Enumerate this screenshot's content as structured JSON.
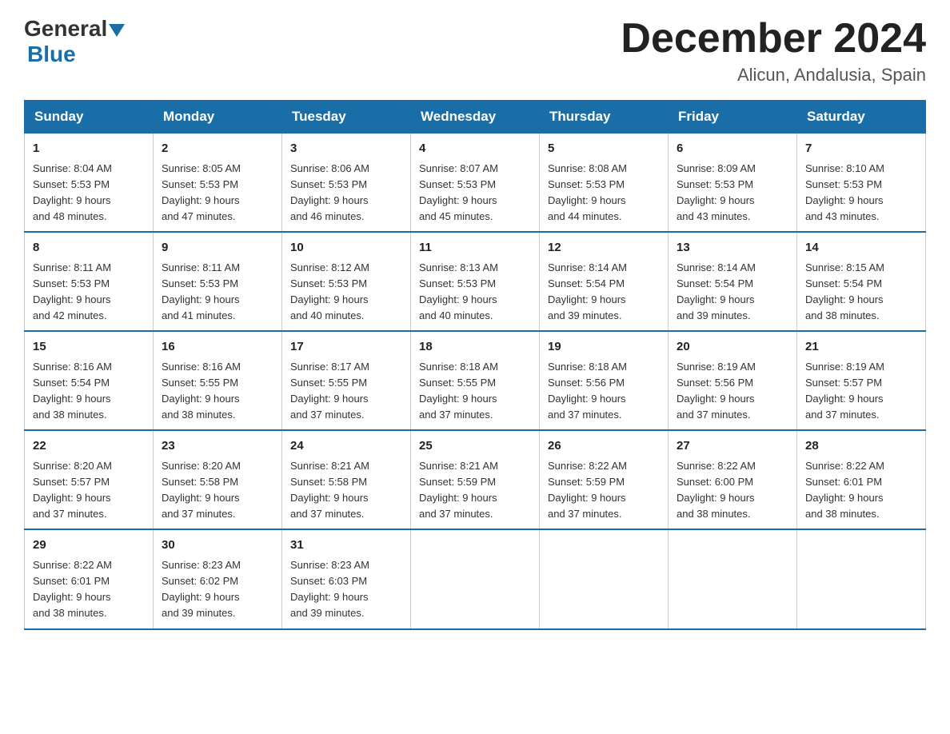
{
  "header": {
    "logo_general": "General",
    "logo_blue": "Blue",
    "month_title": "December 2024",
    "location": "Alicun, Andalusia, Spain"
  },
  "weekdays": [
    "Sunday",
    "Monday",
    "Tuesday",
    "Wednesday",
    "Thursday",
    "Friday",
    "Saturday"
  ],
  "weeks": [
    [
      {
        "day": "1",
        "sunrise": "8:04 AM",
        "sunset": "5:53 PM",
        "daylight": "9 hours and 48 minutes."
      },
      {
        "day": "2",
        "sunrise": "8:05 AM",
        "sunset": "5:53 PM",
        "daylight": "9 hours and 47 minutes."
      },
      {
        "day": "3",
        "sunrise": "8:06 AM",
        "sunset": "5:53 PM",
        "daylight": "9 hours and 46 minutes."
      },
      {
        "day": "4",
        "sunrise": "8:07 AM",
        "sunset": "5:53 PM",
        "daylight": "9 hours and 45 minutes."
      },
      {
        "day": "5",
        "sunrise": "8:08 AM",
        "sunset": "5:53 PM",
        "daylight": "9 hours and 44 minutes."
      },
      {
        "day": "6",
        "sunrise": "8:09 AM",
        "sunset": "5:53 PM",
        "daylight": "9 hours and 43 minutes."
      },
      {
        "day": "7",
        "sunrise": "8:10 AM",
        "sunset": "5:53 PM",
        "daylight": "9 hours and 43 minutes."
      }
    ],
    [
      {
        "day": "8",
        "sunrise": "8:11 AM",
        "sunset": "5:53 PM",
        "daylight": "9 hours and 42 minutes."
      },
      {
        "day": "9",
        "sunrise": "8:11 AM",
        "sunset": "5:53 PM",
        "daylight": "9 hours and 41 minutes."
      },
      {
        "day": "10",
        "sunrise": "8:12 AM",
        "sunset": "5:53 PM",
        "daylight": "9 hours and 40 minutes."
      },
      {
        "day": "11",
        "sunrise": "8:13 AM",
        "sunset": "5:53 PM",
        "daylight": "9 hours and 40 minutes."
      },
      {
        "day": "12",
        "sunrise": "8:14 AM",
        "sunset": "5:54 PM",
        "daylight": "9 hours and 39 minutes."
      },
      {
        "day": "13",
        "sunrise": "8:14 AM",
        "sunset": "5:54 PM",
        "daylight": "9 hours and 39 minutes."
      },
      {
        "day": "14",
        "sunrise": "8:15 AM",
        "sunset": "5:54 PM",
        "daylight": "9 hours and 38 minutes."
      }
    ],
    [
      {
        "day": "15",
        "sunrise": "8:16 AM",
        "sunset": "5:54 PM",
        "daylight": "9 hours and 38 minutes."
      },
      {
        "day": "16",
        "sunrise": "8:16 AM",
        "sunset": "5:55 PM",
        "daylight": "9 hours and 38 minutes."
      },
      {
        "day": "17",
        "sunrise": "8:17 AM",
        "sunset": "5:55 PM",
        "daylight": "9 hours and 37 minutes."
      },
      {
        "day": "18",
        "sunrise": "8:18 AM",
        "sunset": "5:55 PM",
        "daylight": "9 hours and 37 minutes."
      },
      {
        "day": "19",
        "sunrise": "8:18 AM",
        "sunset": "5:56 PM",
        "daylight": "9 hours and 37 minutes."
      },
      {
        "day": "20",
        "sunrise": "8:19 AM",
        "sunset": "5:56 PM",
        "daylight": "9 hours and 37 minutes."
      },
      {
        "day": "21",
        "sunrise": "8:19 AM",
        "sunset": "5:57 PM",
        "daylight": "9 hours and 37 minutes."
      }
    ],
    [
      {
        "day": "22",
        "sunrise": "8:20 AM",
        "sunset": "5:57 PM",
        "daylight": "9 hours and 37 minutes."
      },
      {
        "day": "23",
        "sunrise": "8:20 AM",
        "sunset": "5:58 PM",
        "daylight": "9 hours and 37 minutes."
      },
      {
        "day": "24",
        "sunrise": "8:21 AM",
        "sunset": "5:58 PM",
        "daylight": "9 hours and 37 minutes."
      },
      {
        "day": "25",
        "sunrise": "8:21 AM",
        "sunset": "5:59 PM",
        "daylight": "9 hours and 37 minutes."
      },
      {
        "day": "26",
        "sunrise": "8:22 AM",
        "sunset": "5:59 PM",
        "daylight": "9 hours and 37 minutes."
      },
      {
        "day": "27",
        "sunrise": "8:22 AM",
        "sunset": "6:00 PM",
        "daylight": "9 hours and 38 minutes."
      },
      {
        "day": "28",
        "sunrise": "8:22 AM",
        "sunset": "6:01 PM",
        "daylight": "9 hours and 38 minutes."
      }
    ],
    [
      {
        "day": "29",
        "sunrise": "8:22 AM",
        "sunset": "6:01 PM",
        "daylight": "9 hours and 38 minutes."
      },
      {
        "day": "30",
        "sunrise": "8:23 AM",
        "sunset": "6:02 PM",
        "daylight": "9 hours and 39 minutes."
      },
      {
        "day": "31",
        "sunrise": "8:23 AM",
        "sunset": "6:03 PM",
        "daylight": "9 hours and 39 minutes."
      },
      null,
      null,
      null,
      null
    ]
  ],
  "labels": {
    "sunrise": "Sunrise:",
    "sunset": "Sunset:",
    "daylight": "Daylight:"
  }
}
